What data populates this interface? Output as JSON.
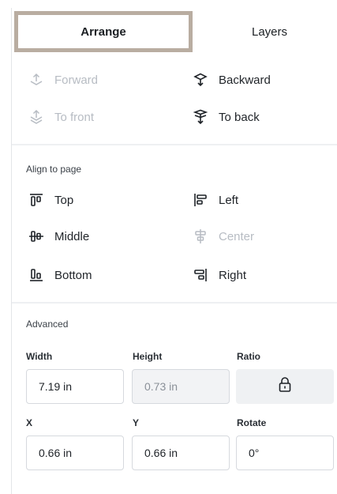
{
  "tabs": {
    "arrange": "Arrange",
    "layers": "Layers"
  },
  "order": {
    "forward": "Forward",
    "backward": "Backward",
    "to_front": "To front",
    "to_back": "To back"
  },
  "align": {
    "title": "Align to page",
    "top": "Top",
    "left": "Left",
    "middle": "Middle",
    "center": "Center",
    "bottom": "Bottom",
    "right": "Right"
  },
  "advanced": {
    "title": "Advanced",
    "width_label": "Width",
    "height_label": "Height",
    "ratio_label": "Ratio",
    "width_value": "7.19 in",
    "height_value": "0.73 in",
    "x_label": "X",
    "y_label": "Y",
    "rotate_label": "Rotate",
    "x_value": "0.66 in",
    "y_value": "0.66 in",
    "rotate_value": "0°"
  }
}
